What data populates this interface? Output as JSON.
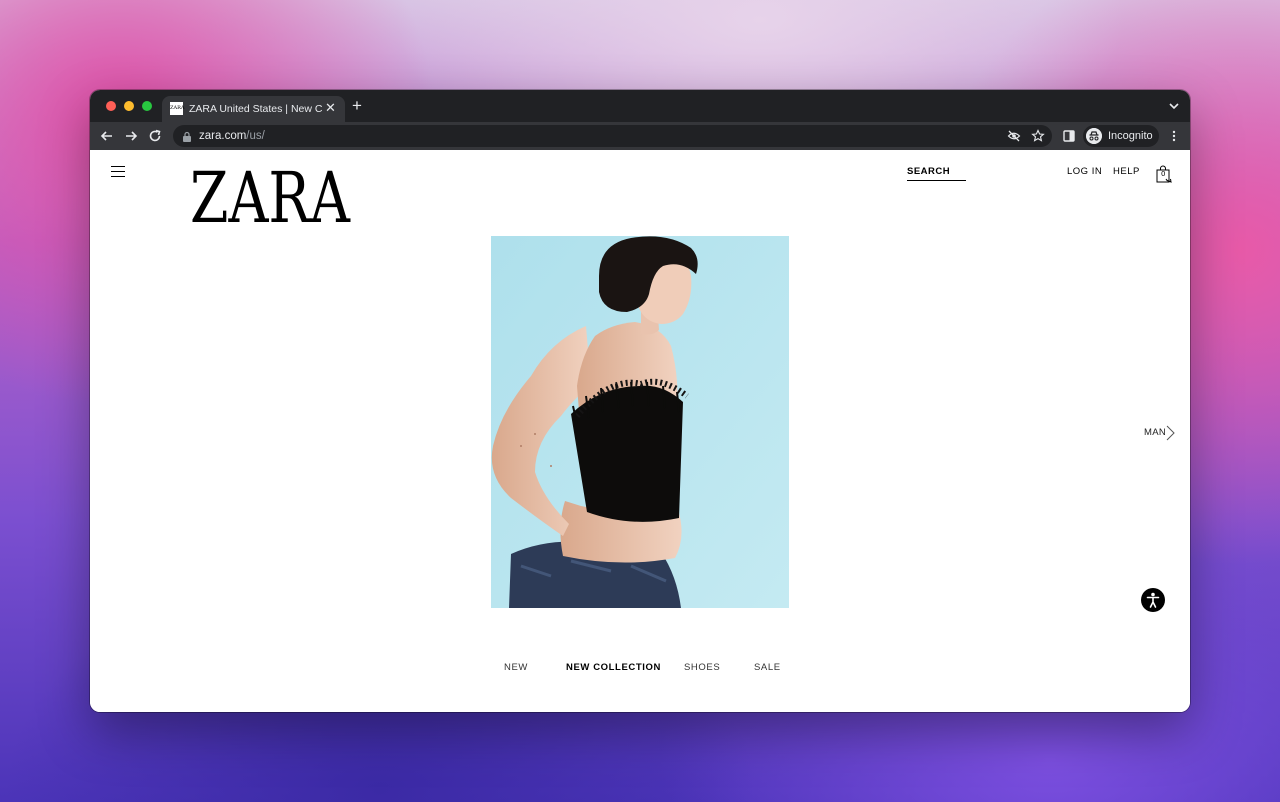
{
  "browser": {
    "tab": {
      "title": "ZARA United States | New Collection",
      "favicon_text": "ZARA"
    },
    "address_bar": {
      "url_host": "zara.com",
      "url_path": "/us/"
    },
    "profile_label": "Incognito"
  },
  "site": {
    "logo_text": "ZARA",
    "header": {
      "search_label": "SEARCH",
      "login_label": "LOG IN",
      "help_label": "HELP",
      "bag_count": "0"
    },
    "side_nav": {
      "man_label": "MAN"
    },
    "bottom_nav": {
      "items": [
        {
          "label": "NEW"
        },
        {
          "label": "NEW COLLECTION"
        },
        {
          "label": "SHOES"
        },
        {
          "label": "SALE"
        }
      ],
      "active_index": 1
    }
  },
  "colors": {
    "tab_bar": "#202124",
    "toolbar": "#35363a",
    "hero_background": "#b3e1ec",
    "text": "#000000"
  }
}
